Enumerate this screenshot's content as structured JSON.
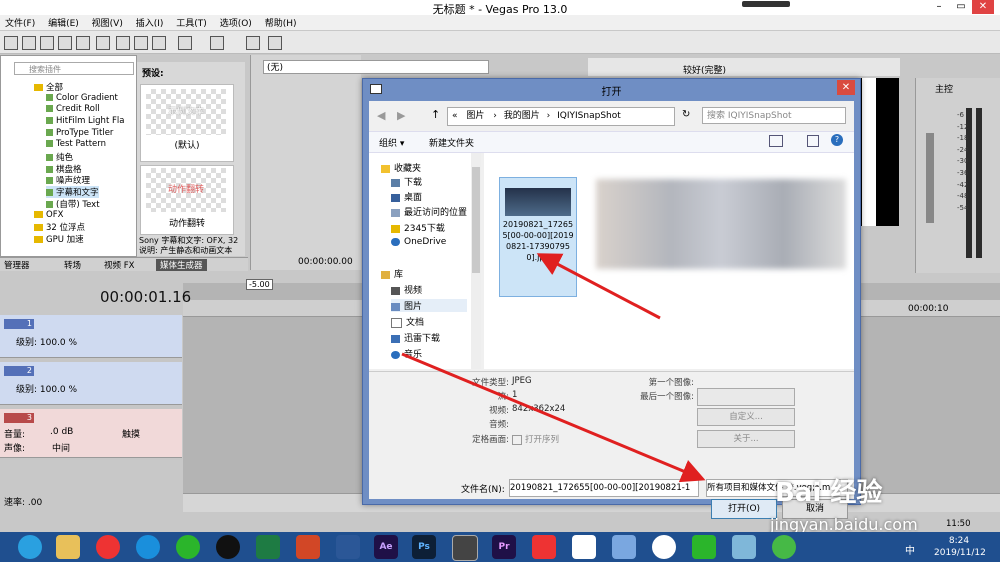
{
  "window": {
    "title": "无标题 * - Vegas Pro 13.0",
    "controls": {
      "minimize": "–",
      "maximize": "▭",
      "close": "✕"
    }
  },
  "menu": [
    "文件(F)",
    "编辑(E)",
    "视图(V)",
    "插入(I)",
    "工具(T)",
    "选项(O)",
    "帮助(H)"
  ],
  "explorer": {
    "search_placeholder": "搜索插件",
    "tree": [
      "全部",
      "Color Gradient",
      "Credit Roll",
      "HitFilm Light Fla",
      "ProType Titler",
      "Test Pattern",
      "纯色",
      "棋盘格",
      "噪声纹理",
      "字幕和文字",
      "(自带) Text",
      "OFX",
      "32 位浮点",
      "GPU 加速"
    ],
    "preset_label": "预设:",
    "presets": [
      {
        "thumb_text": "示例文本",
        "label": "(默认)"
      },
      {
        "thumb_text": "动作翻转",
        "label": "动作翻转"
      }
    ],
    "description_line1": "Sony 字幕和文字: OFX, 32",
    "description_line2": "说明: 产生静态和动画文本",
    "tabs": [
      "管理器",
      "转场",
      "视频 FX",
      "媒体生成器"
    ]
  },
  "preview": {
    "combo_value": "(无)",
    "time": "00:00:00.00",
    "quality": "较好(完整)"
  },
  "master": {
    "label": "主控",
    "meter_scale": [
      "-6",
      "-12",
      "-18",
      "-24",
      "-30",
      "-36",
      "-42",
      "-48",
      "-54"
    ]
  },
  "timeline": {
    "time_display": "00:00:01.16",
    "marker": "-5.00",
    "ruler_label": "00:00:10",
    "rate_label": "速率: .00",
    "end_time": "11:50",
    "tracks": [
      {
        "num": "1",
        "level_label": "级别: 100.0 %"
      },
      {
        "num": "2",
        "level_label": "级别: 100.0 %"
      },
      {
        "num": "3",
        "volume_label": "音量:",
        "volume_value": ".0 dB",
        "pan_label": "声像:",
        "pan_value": "中间",
        "mode": "触摸"
      }
    ]
  },
  "dialog": {
    "title": "打开",
    "breadcrumb": [
      "«",
      "图片",
      "我的图片",
      "IQIYISnapShot"
    ],
    "search_placeholder": "搜索 IQIYISnapShot",
    "organize": "组织 ▾",
    "new_folder": "新建文件夹",
    "nav": {
      "favorites_header": "收藏夹",
      "favorites": [
        "下载",
        "桌面",
        "最近访问的位置",
        "2345下载",
        "OneDrive"
      ],
      "library_header": "库",
      "library": [
        "视频",
        "图片",
        "文档",
        "迅雷下载",
        "音乐"
      ]
    },
    "file": {
      "name": "20190821_172655[00-00-00][20190821-173907950].jpg"
    },
    "details": {
      "file_type_label": "文件类型:",
      "file_type": "JPEG",
      "streams_label": "流:",
      "streams": "1",
      "video_label": "视频:",
      "video": "842x362x24",
      "audio_label": "音频:",
      "audio": "",
      "still_label": "定格画面:",
      "open_sequence": "打开序列",
      "first_image_label": "第一个图像:",
      "last_image_label": "最后一个图像:",
      "custom_button": "自定义...",
      "about_button": "关于..."
    },
    "filename_label": "文件名(N):",
    "filename_value": "20190821_172655[00-00-00][20190821-1",
    "filetype_value": "所有项目和媒体文件 (*.veg;*.m",
    "open_button": "打开(O)",
    "cancel_button": "取消"
  },
  "taskbar": {
    "time": "8:24",
    "date": "2019/11/12",
    "tray_ime": "中",
    "apps": [
      "Ae",
      "Ps",
      "Pr"
    ]
  },
  "watermark": {
    "brand": "Bai 经验",
    "url": "jingyan.baidu.com"
  },
  "colors": {
    "dialog_frame": "#6f8ec4",
    "annotation_arrow": "#e02020",
    "taskbar": "#1f4f8f",
    "selection": "#cce4f7"
  }
}
